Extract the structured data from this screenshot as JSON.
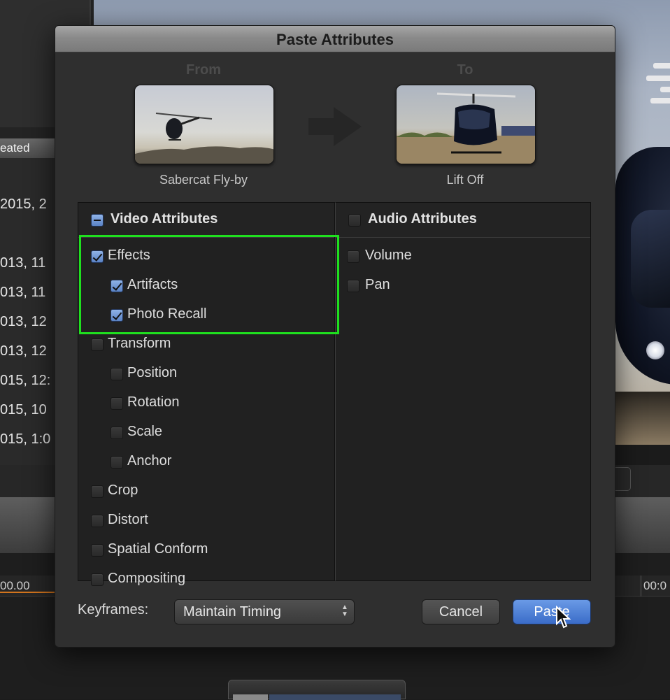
{
  "background": {
    "list_header": "eated",
    "list_dates": [
      "2015, 2",
      "013, 11",
      "013, 11",
      "013, 12",
      "013, 12",
      "015, 12:",
      "015, 10",
      "015, 1:0"
    ],
    "timeline_left_tc": "00.00",
    "timeline_right_tc": "00:0"
  },
  "dialog": {
    "title": "Paste Attributes",
    "from_label": "From",
    "to_label": "To",
    "from_clip": "Sabercat Fly-by",
    "to_clip": "Lift Off",
    "video": {
      "title": "Video Attributes",
      "state": "mixed",
      "items": [
        {
          "label": "Effects",
          "checked": true,
          "indent": 0
        },
        {
          "label": "Artifacts",
          "checked": true,
          "indent": 1
        },
        {
          "label": "Photo Recall",
          "checked": true,
          "indent": 1
        },
        {
          "label": "Transform",
          "checked": false,
          "indent": 0
        },
        {
          "label": "Position",
          "checked": false,
          "indent": 1
        },
        {
          "label": "Rotation",
          "checked": false,
          "indent": 1
        },
        {
          "label": "Scale",
          "checked": false,
          "indent": 1
        },
        {
          "label": "Anchor",
          "checked": false,
          "indent": 1
        },
        {
          "label": "Crop",
          "checked": false,
          "indent": 0
        },
        {
          "label": "Distort",
          "checked": false,
          "indent": 0
        },
        {
          "label": "Spatial Conform",
          "checked": false,
          "indent": 0
        },
        {
          "label": "Compositing",
          "checked": false,
          "indent": 0
        }
      ]
    },
    "audio": {
      "title": "Audio Attributes",
      "state": "unchecked",
      "items": [
        {
          "label": "Volume",
          "checked": false
        },
        {
          "label": "Pan",
          "checked": false
        }
      ]
    },
    "keyframes_label": "Keyframes:",
    "keyframes_value": "Maintain Timing",
    "cancel_label": "Cancel",
    "paste_label": "Paste"
  },
  "colors": {
    "highlight": "#1fe01f",
    "accent": "#4a7fd6"
  }
}
